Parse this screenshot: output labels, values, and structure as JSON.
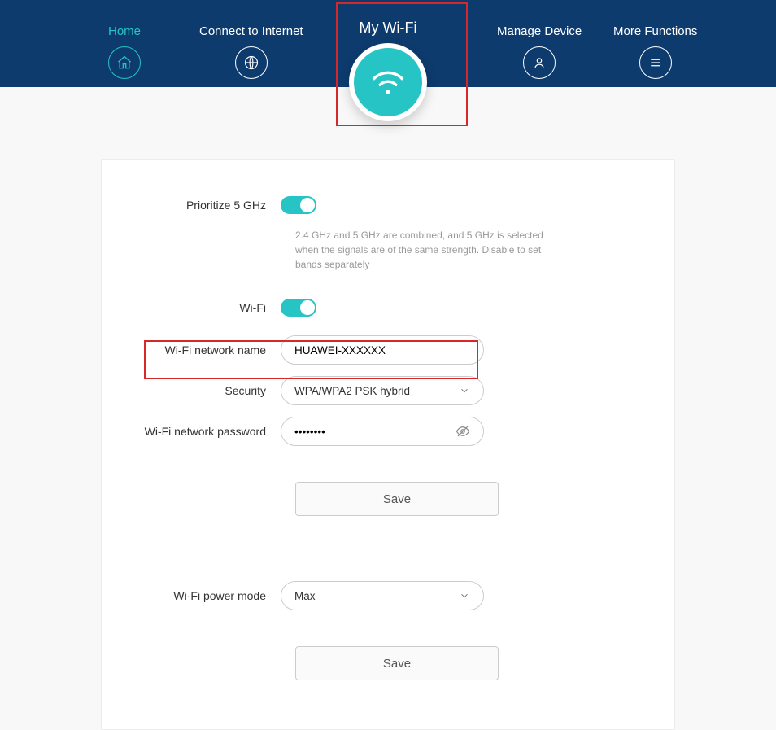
{
  "nav": {
    "home": "Home",
    "connect": "Connect to Internet",
    "wifi": "My Wi-Fi",
    "manage": "Manage Device",
    "more": "More Functions"
  },
  "form": {
    "prioritize_label": "Prioritize 5 GHz",
    "prioritize_help": "2.4 GHz and 5 GHz are combined, and 5 GHz is selected when the signals are of the same strength. Disable to set bands separately",
    "wifi_label": "Wi-Fi",
    "name_label": "Wi-Fi network name",
    "name_value": "HUAWEI-XXXXXX",
    "security_label": "Security",
    "security_value": "WPA/WPA2 PSK hybrid",
    "password_label": "Wi-Fi network password",
    "password_value": "••••••••",
    "save1": "Save",
    "power_label": "Wi-Fi power mode",
    "power_value": "Max",
    "save2": "Save"
  }
}
